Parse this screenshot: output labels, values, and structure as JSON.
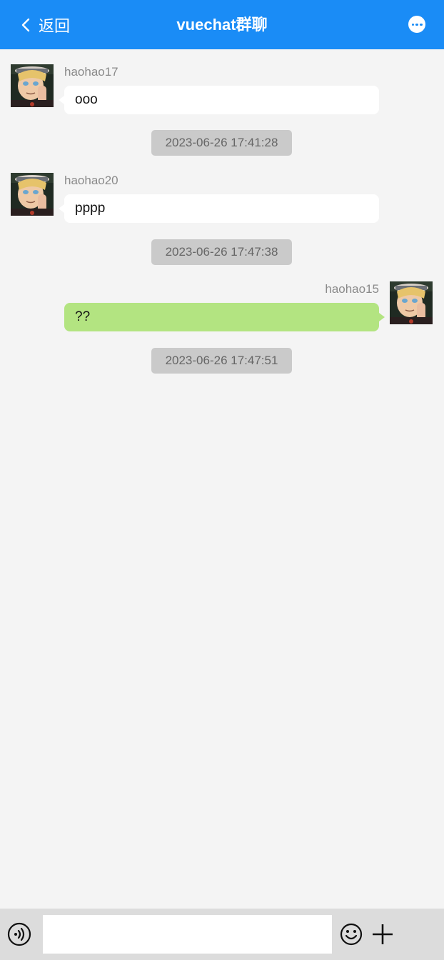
{
  "header": {
    "back_label": "返回",
    "title": "vuechat群聊",
    "background": "#1a8cf6"
  },
  "messages": [
    {
      "side": "left",
      "nick": "haohao17",
      "text": "ooo",
      "time": "2023-06-26 17:41:28"
    },
    {
      "side": "left",
      "nick": "haohao20",
      "text": "pppp",
      "time": "2023-06-26 17:47:38"
    },
    {
      "side": "right",
      "nick": "haohao15",
      "text": "??",
      "time": "2023-06-26 17:47:51"
    }
  ],
  "composer": {
    "input_value": "",
    "input_placeholder": ""
  },
  "icons": {
    "back": "chevron-left-icon",
    "more": "more-horizontal-icon",
    "voice": "voice-icon",
    "emoji": "emoji-icon",
    "plus": "plus-icon"
  },
  "colors": {
    "own_bubble": "#b3e481",
    "other_bubble": "#ffffff",
    "timestamp_bg": "#cacaca"
  }
}
